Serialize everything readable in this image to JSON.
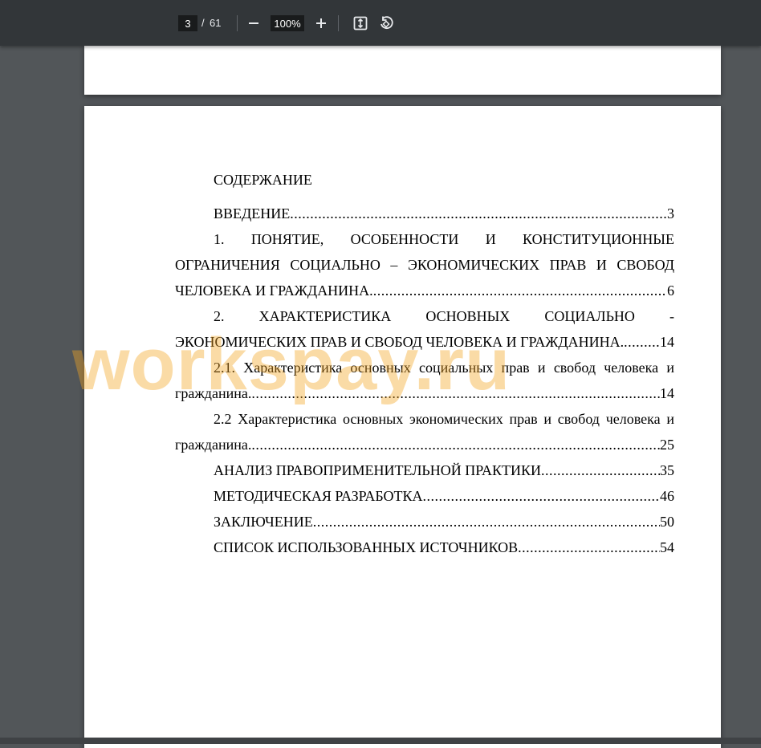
{
  "toolbar": {
    "current_page": "3",
    "separator": "/",
    "total_pages": "61",
    "zoom": "100%",
    "icons": {
      "zoom_out": "minus-icon",
      "zoom_in": "plus-icon",
      "fit_page": "fit-page-icon",
      "rotate": "rotate-icon"
    }
  },
  "document": {
    "toc_title": "СОДЕРЖАНИЕ",
    "entries": [
      {
        "text": "ВВЕДЕНИЕ",
        "page": "3"
      },
      {
        "line1": "1. ПОНЯТИЕ, ОСОБЕННОСТИ И КОНСТИТУЦИОННЫЕ ОГРАНИЧЕНИЯ СОЦИАЛЬНО – ЭКОНОМИЧЕСКИХ ПРАВ И СВОБОД",
        "text": "ЧЕЛОВЕКА И ГРАЖДАНИНА.",
        "page": "6"
      },
      {
        "line1": "2. ХАРАКТЕРИСТИКА ОСНОВНЫХ СОЦИАЛЬНО -",
        "text": "ЭКОНОМИЧЕСКИХ ПРАВ И СВОБОД ЧЕЛОВЕКА И ГРАЖДАНИНА.",
        "page": "14"
      },
      {
        "line1": "2.1. Характеристика основных социальных прав и свобод человека и",
        "text": "гражданина.",
        "page": "14"
      },
      {
        "line1": "2.2 Характеристика основных экономических прав и свобод человека и",
        "text": "гражданина.",
        "page": "25"
      },
      {
        "text": "АНАЛИЗ ПРАВОПРИМЕНИТЕЛЬНОЙ ПРАКТИКИ",
        "page": "35"
      },
      {
        "text": "МЕТОДИЧЕСКАЯ РАЗРАБОТКА",
        "page": "46"
      },
      {
        "text": "ЗАКЛЮЧЕНИЕ",
        "page": "50"
      },
      {
        "text": "СПИСОК ИСПОЛЬЗОВАННЫХ ИСТОЧНИКОВ",
        "page": "54"
      }
    ]
  },
  "watermark": "workspay.ru",
  "colors": {
    "toolbar": "#323639",
    "viewer_background": "#525659",
    "watermark": "#f5a623"
  }
}
